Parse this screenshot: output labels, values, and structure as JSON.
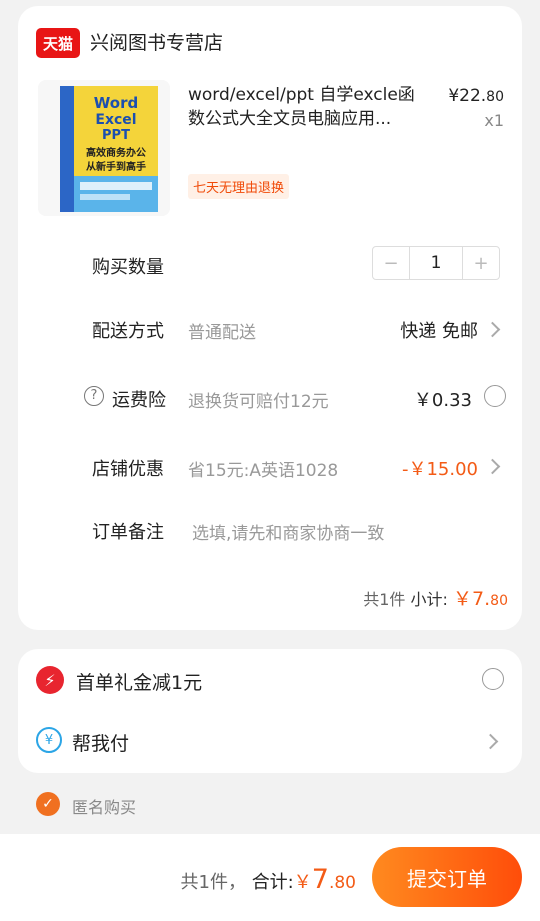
{
  "store": {
    "badge": "天猫",
    "name": "兴阅图书专营店"
  },
  "product": {
    "title": "word/excel/ppt 自学excle函数公式大全文员电脑应用...",
    "price_int": "¥22.",
    "price_dec": "80",
    "quantity_label": "x1",
    "tag": "七天无理由退换",
    "cover_lines": [
      "Word",
      "Excel",
      "PPT",
      "高效商务办公",
      "从新手到高手"
    ]
  },
  "rows": {
    "quantity": {
      "label": "购买数量",
      "value": "1",
      "minus": "−",
      "plus": "+"
    },
    "delivery": {
      "label": "配送方式",
      "hint": "普通配送",
      "value": "快递 免邮"
    },
    "insurance": {
      "label": "运费险",
      "hint": "退换货可赔付12元",
      "value": "￥0.33",
      "help": "?"
    },
    "discount": {
      "label": "店铺优惠",
      "hint": "省15元:A英语1028",
      "value": "-￥15.00"
    },
    "note": {
      "label": "订单备注",
      "placeholder": "选填,请先和商家协商一致"
    }
  },
  "subtotal": {
    "count": "共1件",
    "label": "小计:",
    "int": "￥7.",
    "dec": "80"
  },
  "extras": {
    "first_order": {
      "label": "首单礼金减1元",
      "icon": "⚡"
    },
    "pay_for_me": {
      "label": "帮我付",
      "icon": "¥"
    }
  },
  "anonymous": {
    "label": "匿名购买",
    "check": "✓"
  },
  "footer": {
    "count": "共1件，",
    "label": "合计:",
    "yen": "￥",
    "int": "7",
    "dec": ".80",
    "submit": "提交订单"
  },
  "colors": {
    "accent": "#f35b16",
    "tmall_red": "#e81515",
    "button_start": "#ff8a1f",
    "button_end": "#ff4d0a"
  }
}
